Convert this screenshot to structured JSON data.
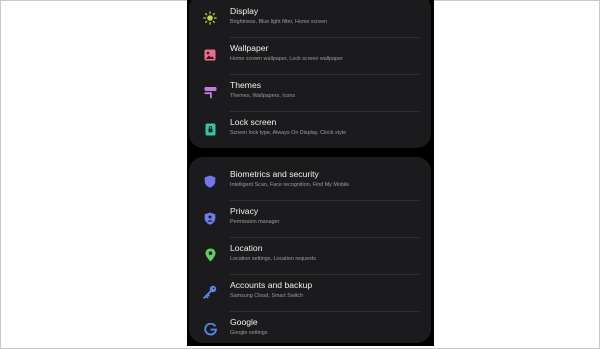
{
  "colors": {
    "card_background": "#1b1b1d",
    "title_text": "#f2f2f2",
    "subtitle_text": "#9d9d9f",
    "display_icon": "#b8df3a",
    "wallpaper_icon": "#f06c8e",
    "themes_icon": "#c47be6",
    "lockscreen_icon": "#34c3a3",
    "security_icon": "#7474ee",
    "privacy_icon": "#6a7ef0",
    "location_icon": "#5fcf5e",
    "accounts_icon": "#5b8bf0",
    "google_icon": "#4f86ec"
  },
  "groups": [
    {
      "items": [
        {
          "icon": "sun-icon",
          "title": "Display",
          "subtitle": "Brightness, Blue light filter, Home screen"
        },
        {
          "icon": "wallpaper-icon",
          "title": "Wallpaper",
          "subtitle": "Home screen wallpaper, Lock screen wallpaper"
        },
        {
          "icon": "paint-roller-icon",
          "title": "Themes",
          "subtitle": "Themes, Wallpapers, Icons"
        },
        {
          "icon": "lock-icon",
          "title": "Lock screen",
          "subtitle": "Screen lock type, Always On Display, Clock style"
        }
      ]
    },
    {
      "items": [
        {
          "icon": "shield-icon",
          "title": "Biometrics and security",
          "subtitle": "Intelligent Scan, Face recognition, Find My Mobile"
        },
        {
          "icon": "privacy-shield-icon",
          "title": "Privacy",
          "subtitle": "Permission manager"
        },
        {
          "icon": "location-pin-icon",
          "title": "Location",
          "subtitle": "Location settings, Location requests"
        },
        {
          "icon": "key-icon",
          "title": "Accounts and backup",
          "subtitle": "Samsung Cloud, Smart Switch"
        },
        {
          "icon": "google-icon",
          "title": "Google",
          "subtitle": "Google settings"
        }
      ]
    }
  ]
}
